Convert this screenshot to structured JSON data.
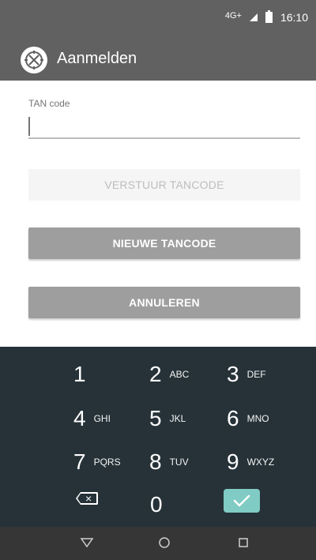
{
  "status_bar": {
    "network": "4G+",
    "time": "16:10",
    "icons": [
      "signal-icon",
      "battery-icon"
    ]
  },
  "app_bar": {
    "title": "Aanmelden",
    "logo_icon": "crosshair-logo-icon"
  },
  "form": {
    "tan_label": "TAN code",
    "tan_value": ""
  },
  "buttons": {
    "send_label": "VERSTUUR TANCODE",
    "new_label": "NIEUWE TANCODE",
    "cancel_label": "ANNULEREN"
  },
  "keyboard": {
    "keys": [
      {
        "main": "1",
        "sub": ""
      },
      {
        "main": "2",
        "sub": "ABC"
      },
      {
        "main": "3",
        "sub": "DEF"
      },
      {
        "main": "4",
        "sub": "GHI"
      },
      {
        "main": "5",
        "sub": "JKL"
      },
      {
        "main": "6",
        "sub": "MNO"
      },
      {
        "main": "7",
        "sub": "PQRS"
      },
      {
        "main": "8",
        "sub": "TUV"
      },
      {
        "main": "9",
        "sub": "WXYZ"
      },
      {
        "main": "0",
        "sub": ""
      }
    ],
    "delete_icon": "backspace-icon",
    "enter_icon": "check-icon"
  },
  "nav": {
    "back_icon": "triangle-back-icon",
    "home_icon": "circle-home-icon",
    "recent_icon": "square-recents-icon"
  },
  "colors": {
    "primary_gray": "#616161",
    "button_gray": "#9e9e9e",
    "keyboard_bg": "#263238",
    "accent_teal": "#80cbc4"
  }
}
